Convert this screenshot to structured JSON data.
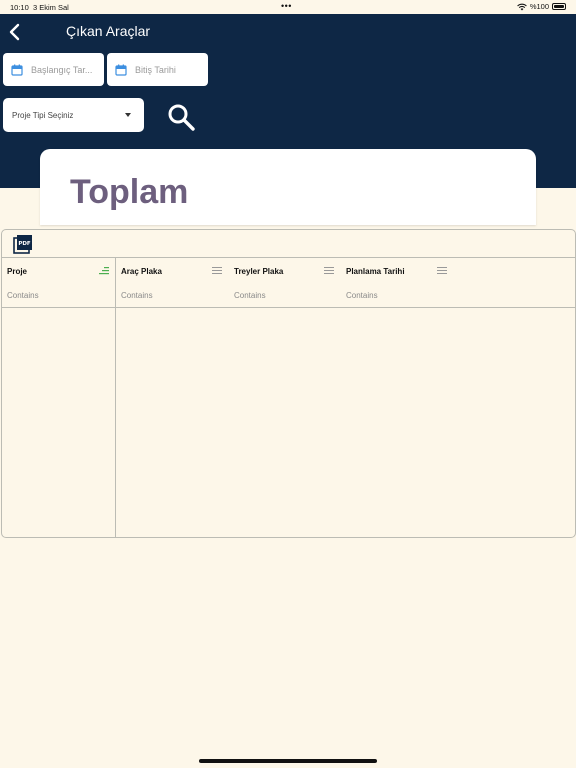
{
  "status_bar": {
    "time": "10:10",
    "date": "3 Ekim Sal",
    "dots": "•••",
    "battery": "%100"
  },
  "header": {
    "title": "Çıkan Araçlar",
    "back_icon": "chevron-left-icon"
  },
  "filters": {
    "start_date_placeholder": "Başlangıç Tar...",
    "end_date_placeholder": "Bitiş Tarihi",
    "project_type_placeholder": "Proje Tipi Seçiniz",
    "calendar_icon": "calendar-icon",
    "search_icon": "search-icon"
  },
  "summary": {
    "title": "Toplam"
  },
  "grid": {
    "export_icon": "pdf-icon",
    "filter_placeholder": "Contains",
    "columns": [
      {
        "title": "Proje",
        "menu_icon": "filter-active-icon"
      },
      {
        "title": "Araç Plaka",
        "menu_icon": "menu-icon"
      },
      {
        "title": "Treyler Plaka",
        "menu_icon": "menu-icon"
      },
      {
        "title": "Planlama Tarihi",
        "menu_icon": "menu-icon"
      }
    ]
  },
  "colors": {
    "header_bg": "#0e2745",
    "page_bg": "#fdf7e9",
    "title_purple": "#6d5f7e",
    "calendar_blue": "#3d8fe0",
    "filter_green": "#4caf50"
  }
}
